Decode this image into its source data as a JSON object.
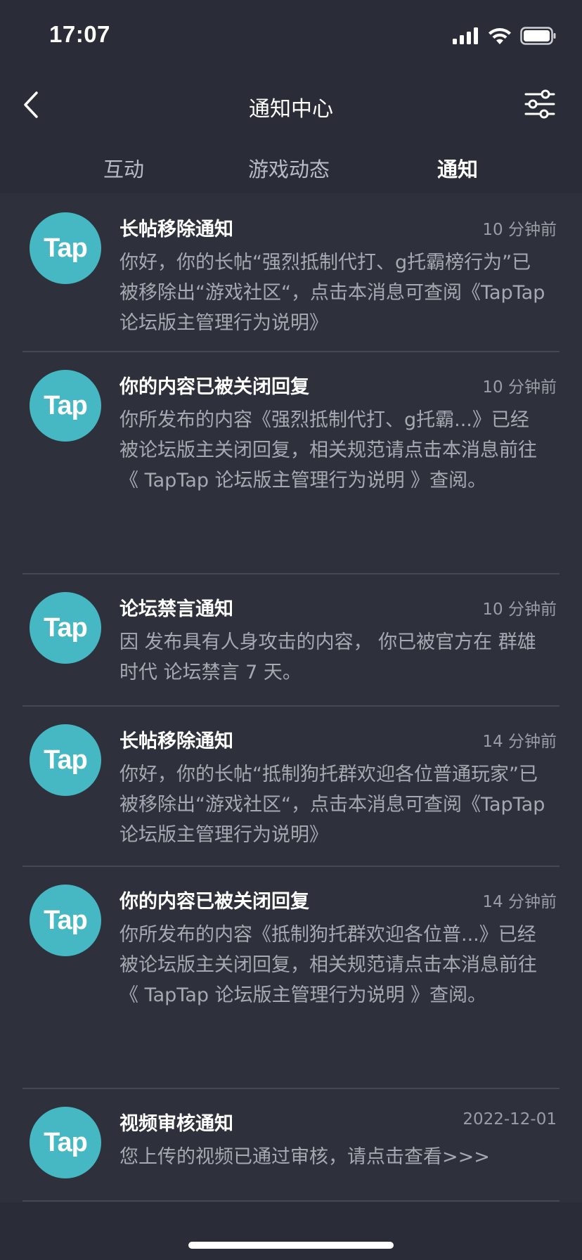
{
  "status_bar": {
    "time": "17:07",
    "icons": [
      "signal-icon",
      "wifi-icon",
      "battery-icon"
    ]
  },
  "nav": {
    "title": "通知中心",
    "back_icon": "chevron-left-icon",
    "filter_icon": "sliders-icon"
  },
  "tabs": [
    {
      "label": "互动",
      "active": false
    },
    {
      "label": "游戏动态",
      "active": false
    },
    {
      "label": "通知",
      "active": true
    }
  ],
  "notifications": [
    {
      "avatar": "Tap",
      "title": "长帖移除通知",
      "time": "10 分钟前",
      "body": "你好，你的长帖“强烈抵制代打、g托霸榜行为”已被移除出“游戏社区“，点击本消息可查阅《TapTap论坛版主管理行为说明》"
    },
    {
      "avatar": "Tap",
      "title": "你的内容已被关闭回复",
      "time": "10 分钟前",
      "body": "你所发布的内容《强烈抵制代打、g托霸...》已经被论坛版主关闭回复，相关规范请点击本消息前往《 TapTap 论坛版主管理行为说明 》查阅。"
    },
    {
      "avatar": "Tap",
      "title": "论坛禁言通知",
      "time": "10 分钟前",
      "body": "因 发布具有人身攻击的内容， 你已被官方在 群雄时代 论坛禁言 7 天。"
    },
    {
      "avatar": "Tap",
      "title": "长帖移除通知",
      "time": "14 分钟前",
      "body": "你好，你的长帖“抵制狗托群欢迎各位普通玩家”已被移除出“游戏社区“，点击本消息可查阅《TapTap论坛版主管理行为说明》"
    },
    {
      "avatar": "Tap",
      "title": "你的内容已被关闭回复",
      "time": "14 分钟前",
      "body": "你所发布的内容《抵制狗托群欢迎各位普...》已经被论坛版主关闭回复，相关规范请点击本消息前往《 TapTap 论坛版主管理行为说明 》查阅。"
    },
    {
      "avatar": "Tap",
      "title": "视频审核通知",
      "time": "2022-12-01",
      "body": "您上传的视频已通过审核，请点击查看>>>"
    }
  ]
}
